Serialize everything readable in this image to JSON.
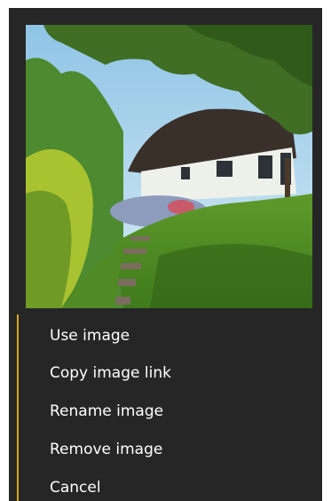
{
  "image_options_menu": {
    "preview": {
      "description_icon": "photo-thumbnail"
    },
    "accent_color": "#d9a514",
    "background_color": "#262626",
    "items": [
      {
        "label": "Use image"
      },
      {
        "label": "Copy image link"
      },
      {
        "label": "Rename image"
      },
      {
        "label": "Remove image"
      },
      {
        "label": "Cancel"
      }
    ]
  }
}
